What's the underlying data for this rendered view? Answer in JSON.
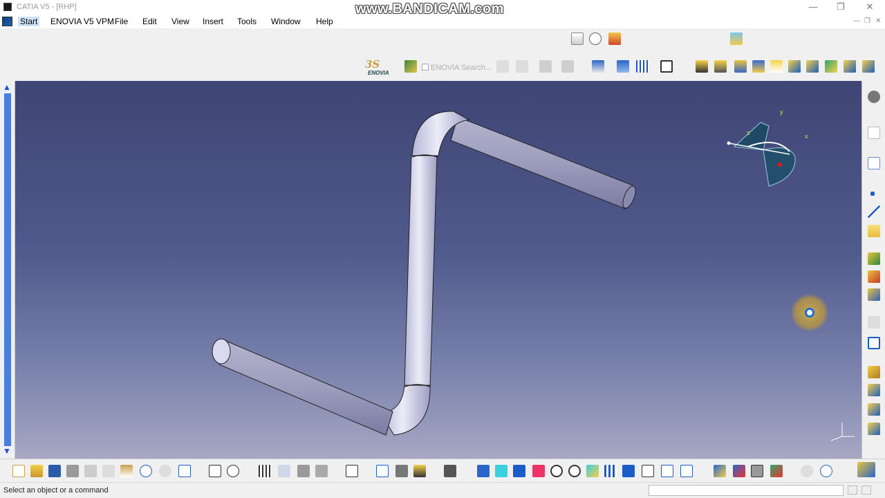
{
  "window": {
    "title": "CATIA V5 - [RHP]",
    "watermark": "www.BANDICAM.com",
    "minimize": "—",
    "restore": "❐",
    "close": "✕"
  },
  "menu": {
    "items": [
      "Start",
      "ENOVIA V5 VPM",
      "File",
      "Edit",
      "View",
      "Insert",
      "Tools",
      "Window",
      "Help"
    ]
  },
  "toolbar": {
    "enovia_logo_ds": "3S",
    "enovia_logo_text": "ENOVIA",
    "enovia_search": "ENOVIA Search..."
  },
  "compass": {
    "x_label": "x",
    "y_label": "y",
    "z_label": "z"
  },
  "status": {
    "message": "Select an object or a command"
  },
  "colors": {
    "viewport_top": "#3f4575",
    "viewport_bottom": "#a6a8c3",
    "pipe": "#c9c9e2",
    "accent": "#1e6fd1"
  }
}
